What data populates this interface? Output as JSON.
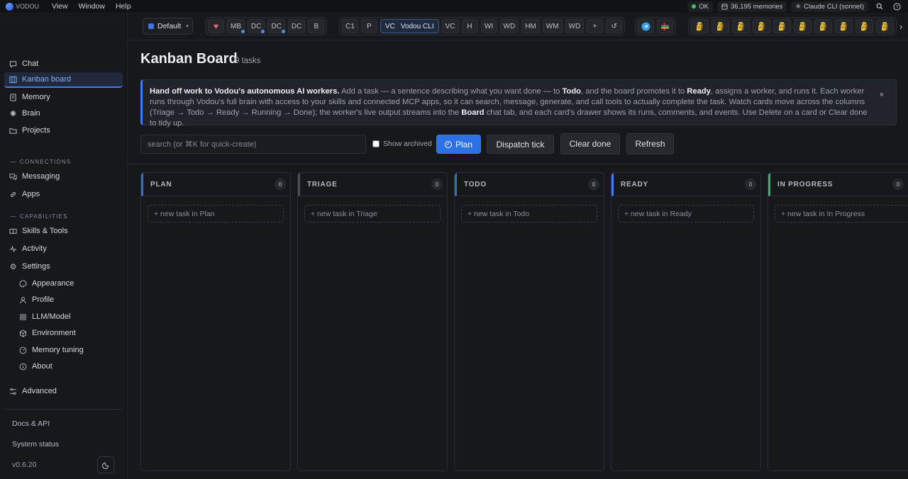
{
  "menubar": {
    "app_name": "VODOU",
    "menus": [
      "View",
      "Window",
      "Help"
    ],
    "status": "OK",
    "memories": "36,195 memories",
    "model": "Claude CLI (sonnet)",
    "colors": {
      "status_ok": "#3cc26a"
    }
  },
  "toolbar": {
    "profile": "Default",
    "group1": [
      "MB",
      "DC",
      "DC",
      "DC",
      "B"
    ],
    "group2": [
      "C1",
      "P"
    ],
    "active_chip": {
      "short": "VC",
      "label": "Vodou CLI"
    },
    "group2_rest": [
      "VC",
      "H",
      "WI",
      "WD",
      "HM",
      "WM",
      "WD",
      "+"
    ],
    "face_count": 10,
    "more": "›"
  },
  "sidebar": {
    "items": [
      {
        "label": "Chat",
        "icon": "chat-icon"
      },
      {
        "label": "Kanban board",
        "icon": "kanban-icon"
      },
      {
        "label": "Memory",
        "icon": "memory-icon"
      },
      {
        "label": "Brain",
        "icon": "brain-icon"
      },
      {
        "label": "Projects",
        "icon": "folder-icon"
      }
    ],
    "connections_label": "CONNECTIONS",
    "connections": [
      {
        "label": "Messaging",
        "icon": "messaging-icon"
      },
      {
        "label": "Apps",
        "icon": "link-icon"
      }
    ],
    "capabilities_label": "CAPABILITIES",
    "capabilities": [
      {
        "label": "Skills & Tools",
        "icon": "book-icon"
      },
      {
        "label": "Activity",
        "icon": "activity-icon"
      },
      {
        "label": "Settings",
        "icon": "gear-icon"
      }
    ],
    "settings_sub": [
      {
        "label": "Appearance",
        "icon": "palette-icon"
      },
      {
        "label": "Profile",
        "icon": "user-icon"
      },
      {
        "label": "LLM/Model",
        "icon": "chip-icon"
      },
      {
        "label": "Environment",
        "icon": "cube-icon"
      },
      {
        "label": "Memory tuning",
        "icon": "gauge-icon"
      },
      {
        "label": "About",
        "icon": "info-icon"
      }
    ],
    "advanced": "Advanced",
    "docs": "Docs & API",
    "system_status": "System status",
    "version": "v0.6.20"
  },
  "main": {
    "title": "Kanban Board",
    "task_count": "9 tasks",
    "banner": {
      "lead": "Hand off work to Vodou's autonomous AI workers.",
      "t1": " Add a task — a sentence describing what you want done — to ",
      "todo": "Todo",
      "t2": ", and the board promotes it to ",
      "ready": "Ready",
      "t3": ", assigns a worker, and runs it. Each worker runs through Vodou's full brain with access to your skills and connected MCP apps, so it can search, message, generate, and call tools to actually complete the task. Watch cards move across the columns (Triage → Todo → Ready → Running → Done); the worker's live output streams into the ",
      "board": "Board",
      "t4": " chat tab, and each card's drawer shows its runs, comments, and events. Use Delete on a card or Clear done to tidy up.",
      "close": "×"
    },
    "search_placeholder": "search (or ⌘K for quick-create)",
    "show_archived": "Show archived",
    "buttons": {
      "plan": "Plan",
      "dispatch": "Dispatch tick",
      "clear": "Clear done",
      "refresh": "Refresh"
    },
    "columns": [
      {
        "title": "PLAN",
        "count": "0",
        "new": "+ new task in Plan",
        "accent": "#3b6fd8"
      },
      {
        "title": "TRIAGE",
        "count": "0",
        "new": "+ new task in Triage",
        "accent": "#4b4e56"
      },
      {
        "title": "TODO",
        "count": "0",
        "new": "+ new task in Todo",
        "accent": "#3f6ea8"
      },
      {
        "title": "READY",
        "count": "0",
        "new": "+ new task in Ready",
        "accent": "#3b7cf0"
      },
      {
        "title": "IN PROGRESS",
        "count": "0",
        "new": "+ new task in In Progress",
        "accent": "#2fb57a"
      }
    ]
  }
}
